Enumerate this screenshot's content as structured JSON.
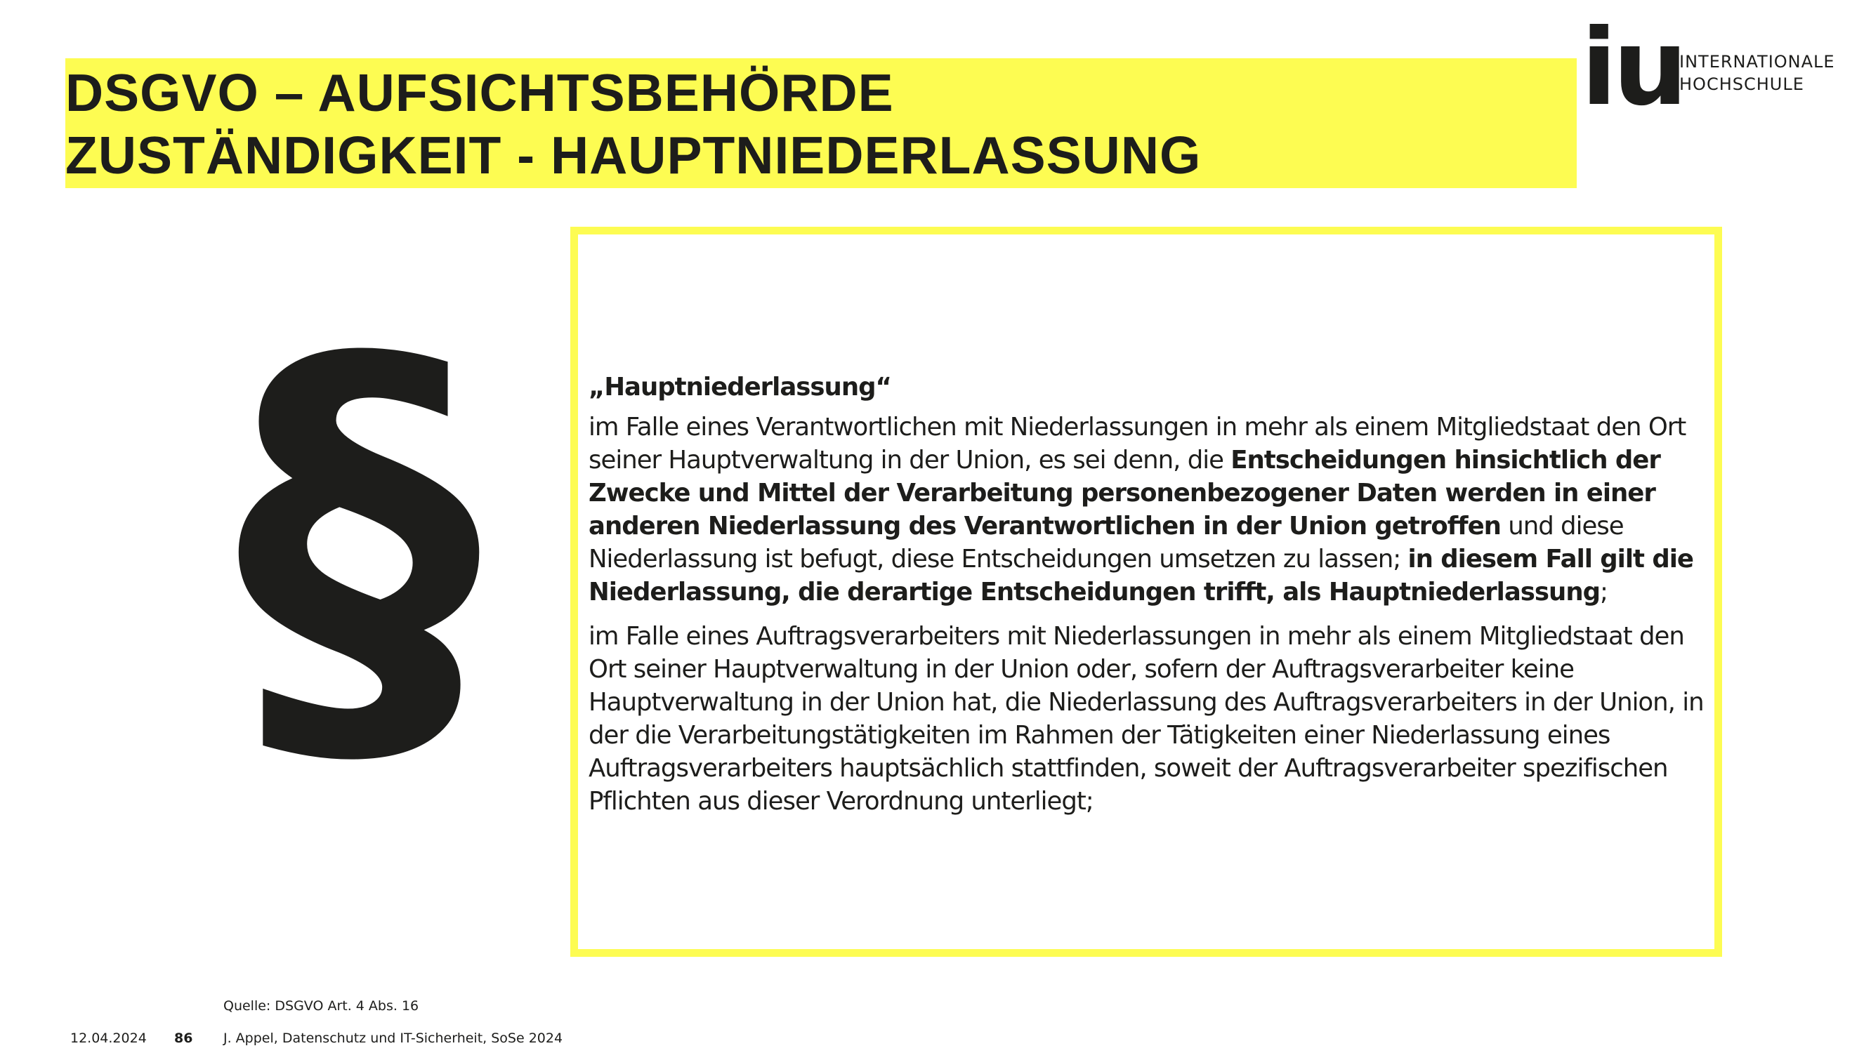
{
  "title": {
    "line1": "DSGVO – AUFSICHTSBEHÖRDE",
    "line2": "ZUSTÄNDIGKEIT - HAUPTNIEDERLASSUNG"
  },
  "logo": {
    "mark": "iu",
    "line1": "INTERNATIONALE",
    "line2": "HOCHSCHULE"
  },
  "icon": "paragraph-sign-icon",
  "quote": {
    "heading": "„Hauptniederlassung“",
    "p1": {
      "t1": "im Falle eines Verantwortlichen mit Niederlassungen in mehr als einem Mitgliedstaat den Ort seiner Hauptverwaltung in der Union, es sei denn, die ",
      "b1": "Entscheidungen hinsichtlich der Zwecke und Mittel der Verarbeitung personenbezogener Daten werden in einer anderen Niederlassung des Verantwortlichen in der Union getroffen",
      "t2": " und diese Niederlassung ist befugt, diese Entscheidungen umsetzen zu lassen; ",
      "b2": "in diesem Fall gilt die Niederlassung, die derartige Entscheidungen trifft, als Hauptniederlassung",
      "t3": ";"
    },
    "p2": "im Falle eines Auftragsverarbeiters mit Niederlassungen in mehr als einem Mitgliedstaat den Ort seiner Hauptverwaltung in der Union oder, sofern der Auftragsverarbeiter keine Hauptverwaltung in der Union hat, die Niederlassung des Auftragsverarbeiters in der Union, in der die Verarbeitungstätigkeiten im Rahmen der Tätigkeiten einer Niederlassung eines Auftragsverarbeiters hauptsächlich stattfinden, soweit der Auftragsverarbeiter spezifischen Pflichten aus dieser Verordnung unterliegt;"
  },
  "footer": {
    "source": "Quelle: DSGVO Art. 4 Abs. 16",
    "date": "12.04.2024",
    "page": "86",
    "author": "J. Appel, Datenschutz und IT-Sicherheit, SoSe 2024"
  },
  "colors": {
    "accent_yellow": "#fdfc52",
    "text": "#1d1d1b"
  }
}
